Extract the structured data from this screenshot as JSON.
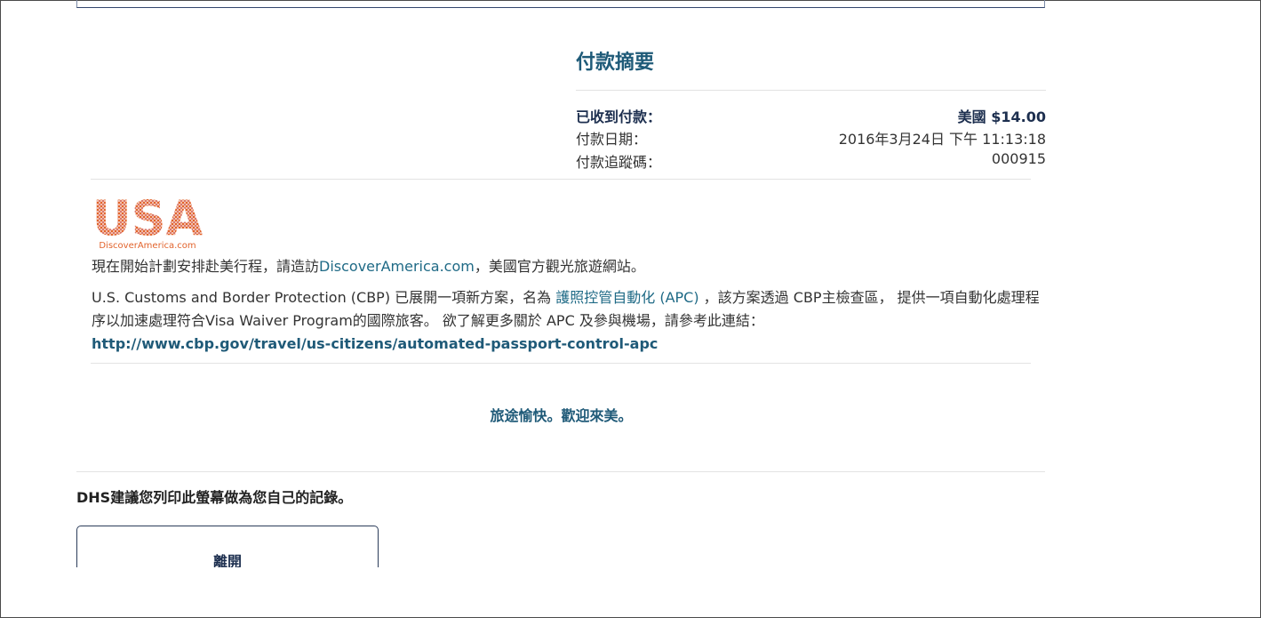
{
  "payment_summary": {
    "title": "付款摘要",
    "rows": [
      {
        "label": "已收到付款：",
        "value": "美國 $14.00"
      },
      {
        "label": "付款日期：",
        "value": "2016年3月24日 下午 11:13:18"
      },
      {
        "label": "付款追蹤碼：",
        "value": "000915"
      }
    ]
  },
  "logo": {
    "text": "USA",
    "caption": "DiscoverAmerica.com"
  },
  "info": {
    "plan_prefix": "現在開始計劃安排赴美行程，請造訪",
    "plan_link": "DiscoverAmerica.com",
    "plan_suffix": "，美國官方觀光旅遊網站。",
    "apc_prefix": "U.S. Customs and Border Protection (CBP) 已展開一項新方案，名為 ",
    "apc_link": "護照控管自動化 (APC)",
    "apc_middle": " ，該方案透過 CBP主檢查區， 提供一項自動化處理程序以加速處理符合Visa Waiver Program的國際旅客。 欲了解更多關於 APC 及參與機場，請參考此連結：",
    "apc_url": "http://www.cbp.gov/travel/us-citizens/automated-passport-control-apc"
  },
  "welcome_text": "旅途愉快。歡迎來美。",
  "dhs_note": "DHS建議您列印此螢幕做為您自己的記錄。",
  "leave_button": "離開",
  "colors": {
    "heading": "#1e5a78",
    "link": "#1f6a86",
    "logo_orange": "#e2632c",
    "logo_red": "#c83a2c",
    "button_border": "#2b3c5a"
  }
}
